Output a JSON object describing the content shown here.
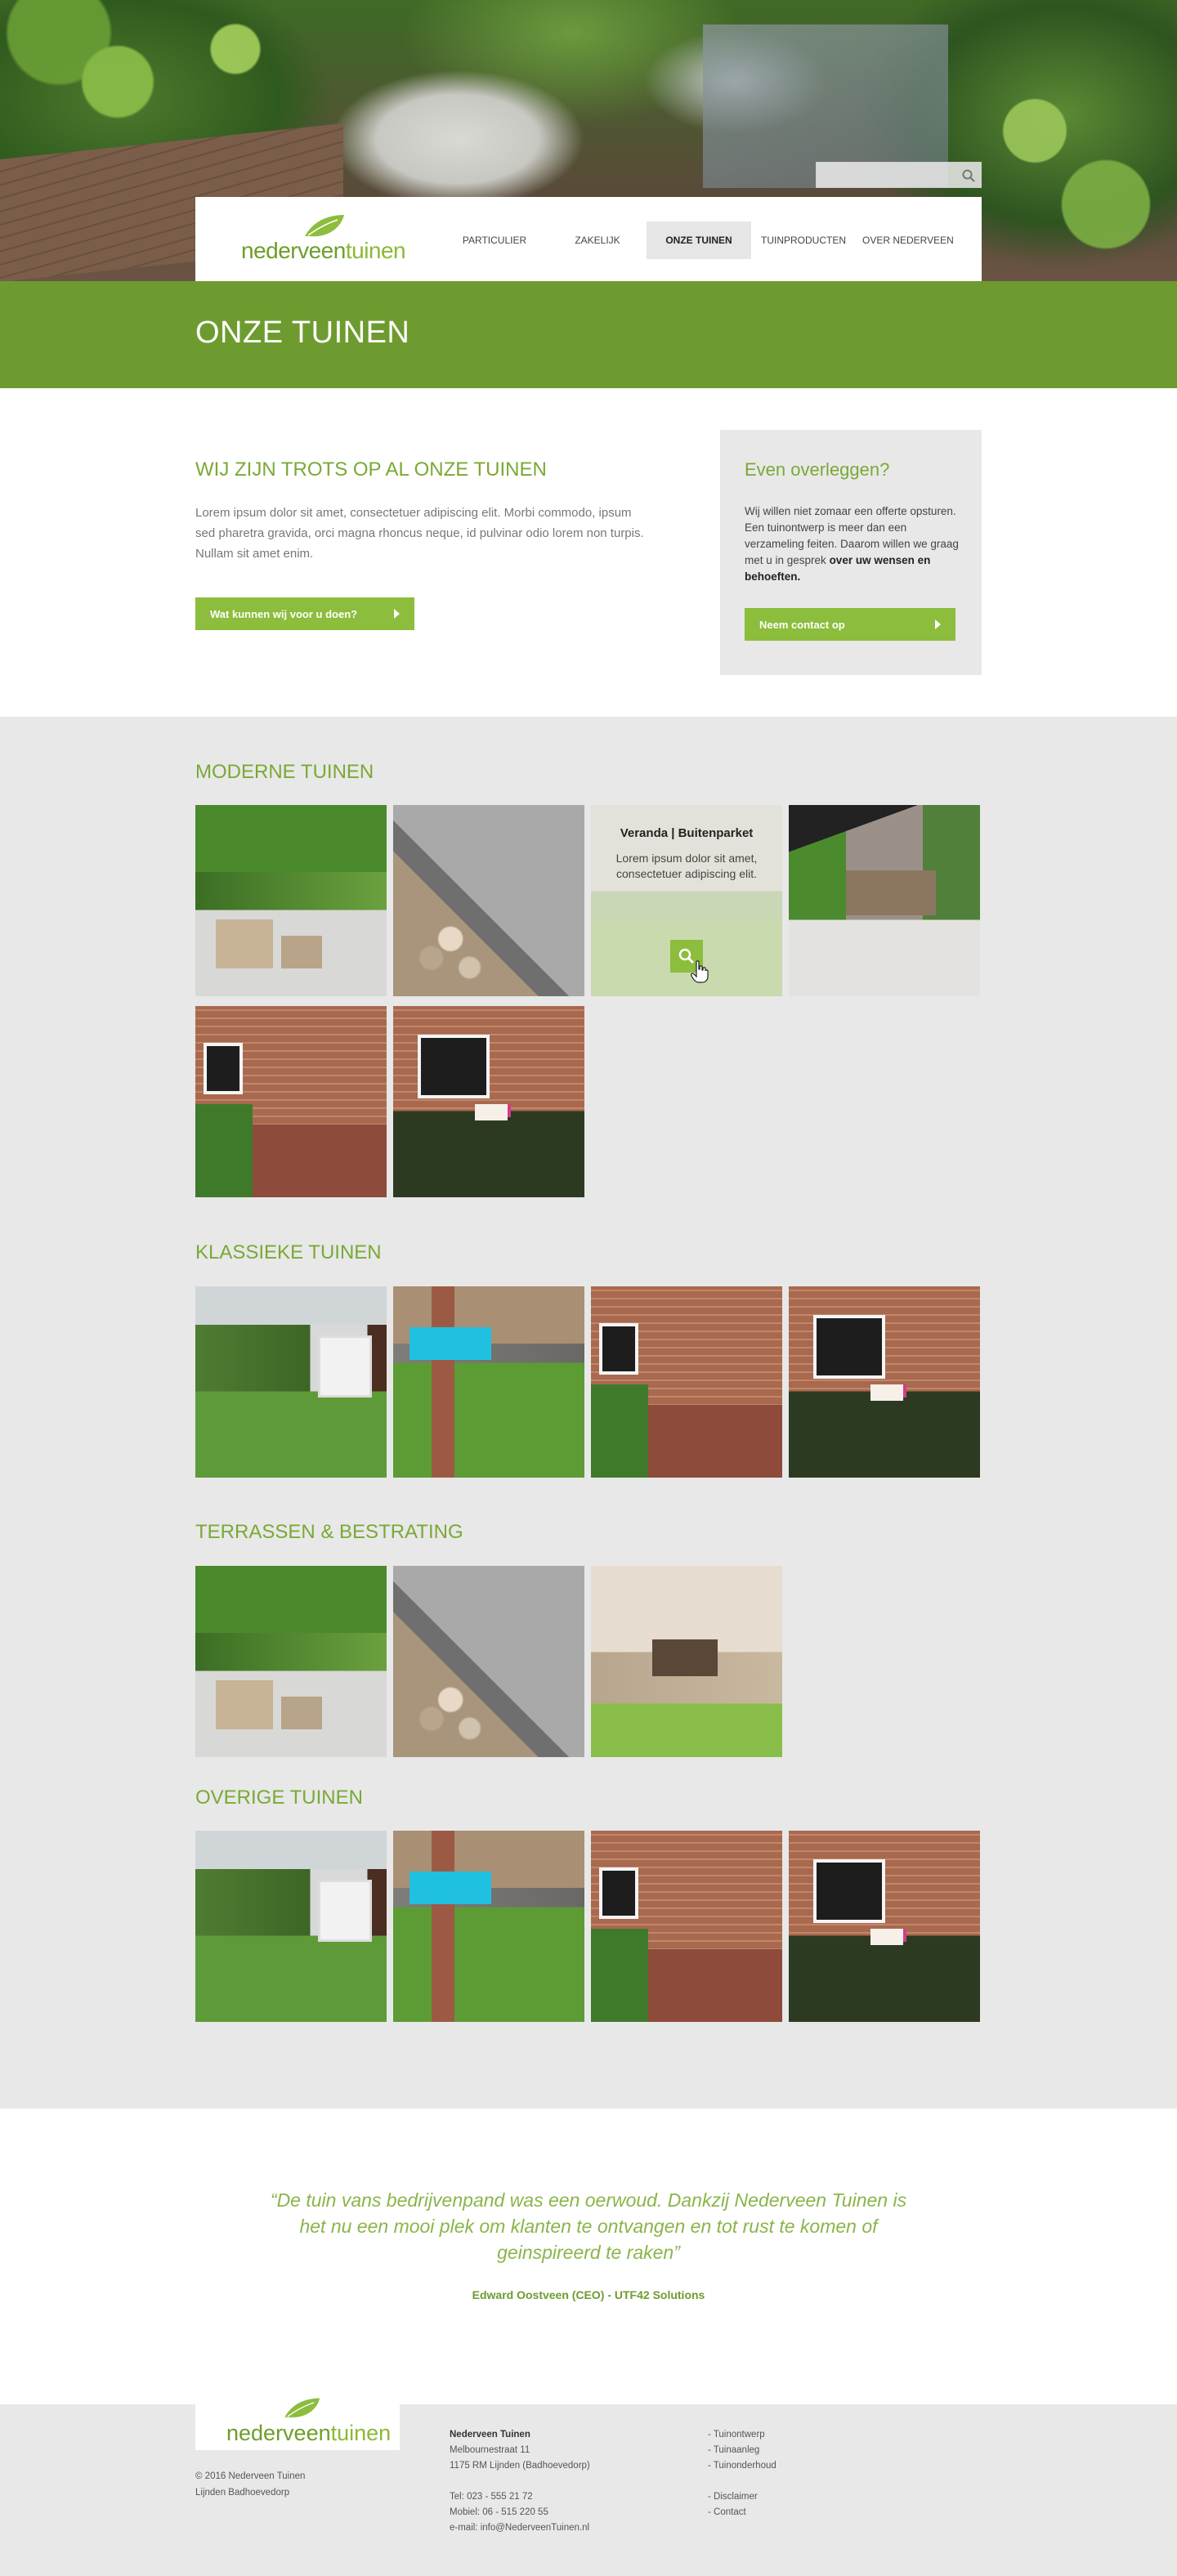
{
  "search": {
    "placeholder": ""
  },
  "brand": {
    "name_part1": "nederveen",
    "name_part2": "tuinen"
  },
  "nav": {
    "items": [
      {
        "label": "PARTICULIER"
      },
      {
        "label": "ZAKELIJK"
      },
      {
        "label": "ONZE TUINEN",
        "active": true
      },
      {
        "label": "TUINPRODUCTEN"
      },
      {
        "label": "OVER NEDERVEEN"
      }
    ]
  },
  "page": {
    "title": "ONZE TUINEN"
  },
  "intro": {
    "heading": "WIJ ZIJN TROTS OP AL ONZE TUINEN",
    "text": "Lorem ipsum dolor sit amet, consectetuer adipiscing elit. Morbi commodo, ipsum sed pharetra gravida, orci magna rhoncus neque, id pulvinar odio lorem non turpis. Nullam sit amet enim.",
    "button": "Wat kunnen wij voor u doen?"
  },
  "contact_box": {
    "heading": "Even overleggen?",
    "text": "Wij willen niet zomaar een offerte opsturen. Een tuinontwerp is meer dan een verzameling feiten. Daarom willen we graag met u in gesprek ",
    "text_bold": "over uw wensen en behoeften.",
    "button": "Neem contact op"
  },
  "galleries": [
    {
      "title": "MODERNE TUINEN"
    },
    {
      "title": "KLASSIEKE TUINEN"
    },
    {
      "title": "TERRASSEN & BESTRATING"
    },
    {
      "title": "OVERIGE TUINEN"
    }
  ],
  "hover_card": {
    "title": "Veranda | Buitenparket",
    "text": "Lorem ipsum dolor sit amet, consectetuer adipiscing elit."
  },
  "testimonial": {
    "quote": "“De tuin vans bedrijvenpand was een oerwoud. Dankzij Nederveen Tuinen is het nu een mooi plek om klanten te ontvangen en tot rust te komen of geinspireerd te raken”",
    "author": "Edward Oostveen (CEO) - UTF42 Solutions"
  },
  "footer": {
    "copyright": "© 2016 Nederveen Tuinen",
    "location": "Lijnden Badhoevedorp",
    "company": "Nederveen Tuinen",
    "street": "Melbournestraat 11",
    "city": "1175 RM Lijnden (Badhoevedorp)",
    "tel": "Tel: 023 - 555 21 72",
    "mobile": "Mobiel: 06 - 515 220 55",
    "email": "e-mail: info@NederveenTuinen.nl",
    "links1": [
      "- Tuinontwerp",
      "- Tuinaanleg",
      "- Tuinonderhoud"
    ],
    "links2": [
      "- Disclaimer",
      "- Contact"
    ]
  },
  "colors": {
    "brand_green": "#6e9b2f",
    "button_green": "#8cbd3c",
    "heading_green": "#7aa935",
    "gallery_bg": "#e8e8e8"
  }
}
